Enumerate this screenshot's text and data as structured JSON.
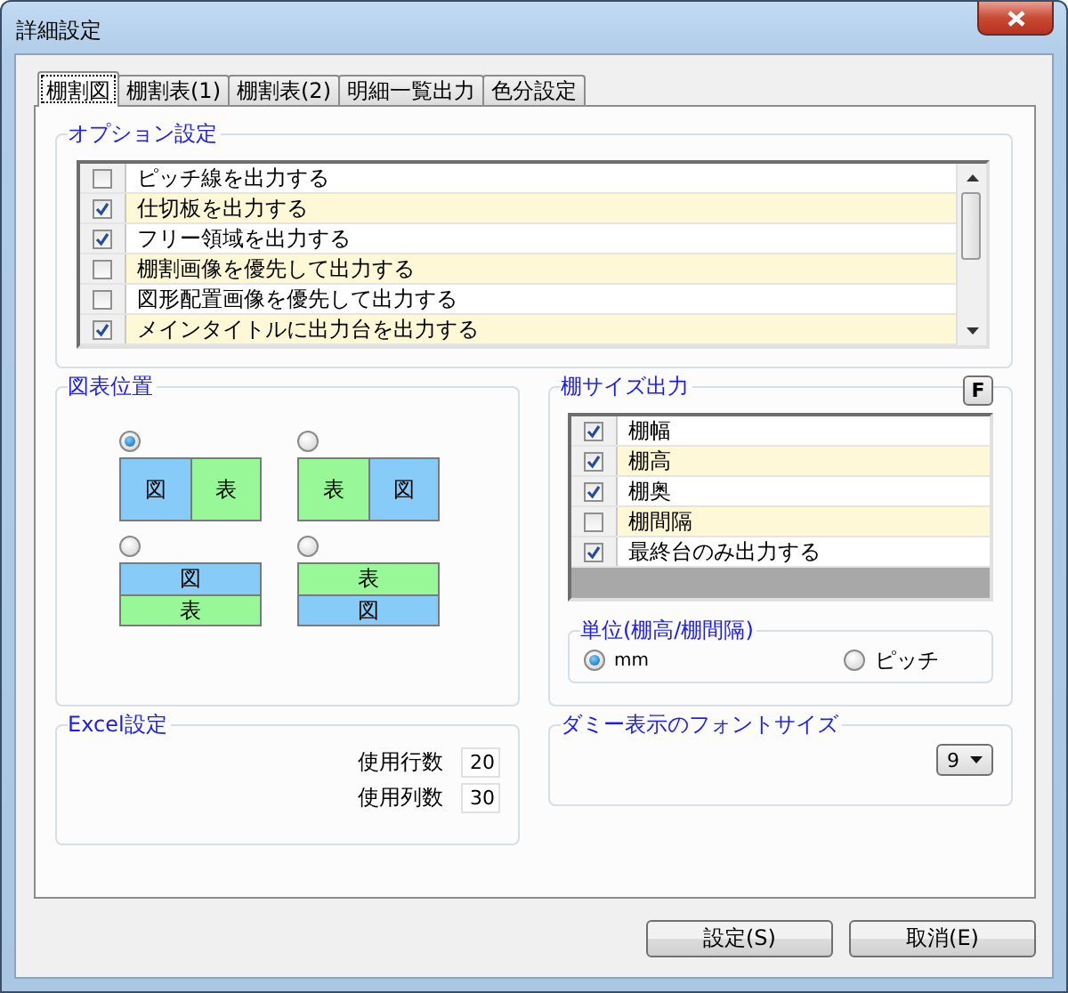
{
  "window": {
    "title": "詳細設定"
  },
  "tabs": [
    {
      "label": "棚割図",
      "selected": true
    },
    {
      "label": "棚割表(1)",
      "selected": false
    },
    {
      "label": "棚割表(2)",
      "selected": false
    },
    {
      "label": "明細一覧出力",
      "selected": false
    },
    {
      "label": "色分設定",
      "selected": false
    }
  ],
  "options": {
    "title": "オプション設定",
    "items": [
      {
        "label": "ピッチ線を出力する",
        "checked": false
      },
      {
        "label": "仕切板を出力する",
        "checked": true
      },
      {
        "label": "フリー領域を出力する",
        "checked": true
      },
      {
        "label": "棚割画像を優先して出力する",
        "checked": false
      },
      {
        "label": "図形配置画像を優先して出力する",
        "checked": false
      },
      {
        "label": "メインタイトルに出力台を出力する",
        "checked": true
      }
    ]
  },
  "layout": {
    "title": "図表位置",
    "choices": [
      {
        "kind": "side",
        "selected": true,
        "cells": [
          {
            "text": "図",
            "color": "#87ccf8"
          },
          {
            "text": "表",
            "color": "#98f898"
          }
        ]
      },
      {
        "kind": "side",
        "selected": false,
        "cells": [
          {
            "text": "表",
            "color": "#98f898"
          },
          {
            "text": "図",
            "color": "#87ccf8"
          }
        ]
      },
      {
        "kind": "stacked",
        "selected": false,
        "cells": [
          {
            "text": "図",
            "color": "#87ccf8"
          },
          {
            "text": "表",
            "color": "#98f898"
          }
        ]
      },
      {
        "kind": "stacked",
        "selected": false,
        "cells": [
          {
            "text": "表",
            "color": "#98f898"
          },
          {
            "text": "図",
            "color": "#87ccf8"
          }
        ]
      }
    ]
  },
  "size_output": {
    "title": "棚サイズ出力",
    "button": "F",
    "items": [
      {
        "label": "棚幅",
        "checked": true
      },
      {
        "label": "棚高",
        "checked": true
      },
      {
        "label": "棚奥",
        "checked": true
      },
      {
        "label": "棚間隔",
        "checked": false
      },
      {
        "label": "最終台のみ出力する",
        "checked": true
      }
    ],
    "unit": {
      "title": "単位(棚高/棚間隔)",
      "options": [
        {
          "label": "mm",
          "selected": true
        },
        {
          "label": "ピッチ",
          "selected": false
        }
      ]
    }
  },
  "excel": {
    "title": "Excel設定",
    "fields": [
      {
        "label": "使用行数",
        "value": "20"
      },
      {
        "label": "使用列数",
        "value": "30"
      }
    ]
  },
  "font_size": {
    "title": "ダミー表示のフォントサイズ",
    "value": "9"
  },
  "buttons": [
    "設定(S)",
    "取消(E)"
  ]
}
